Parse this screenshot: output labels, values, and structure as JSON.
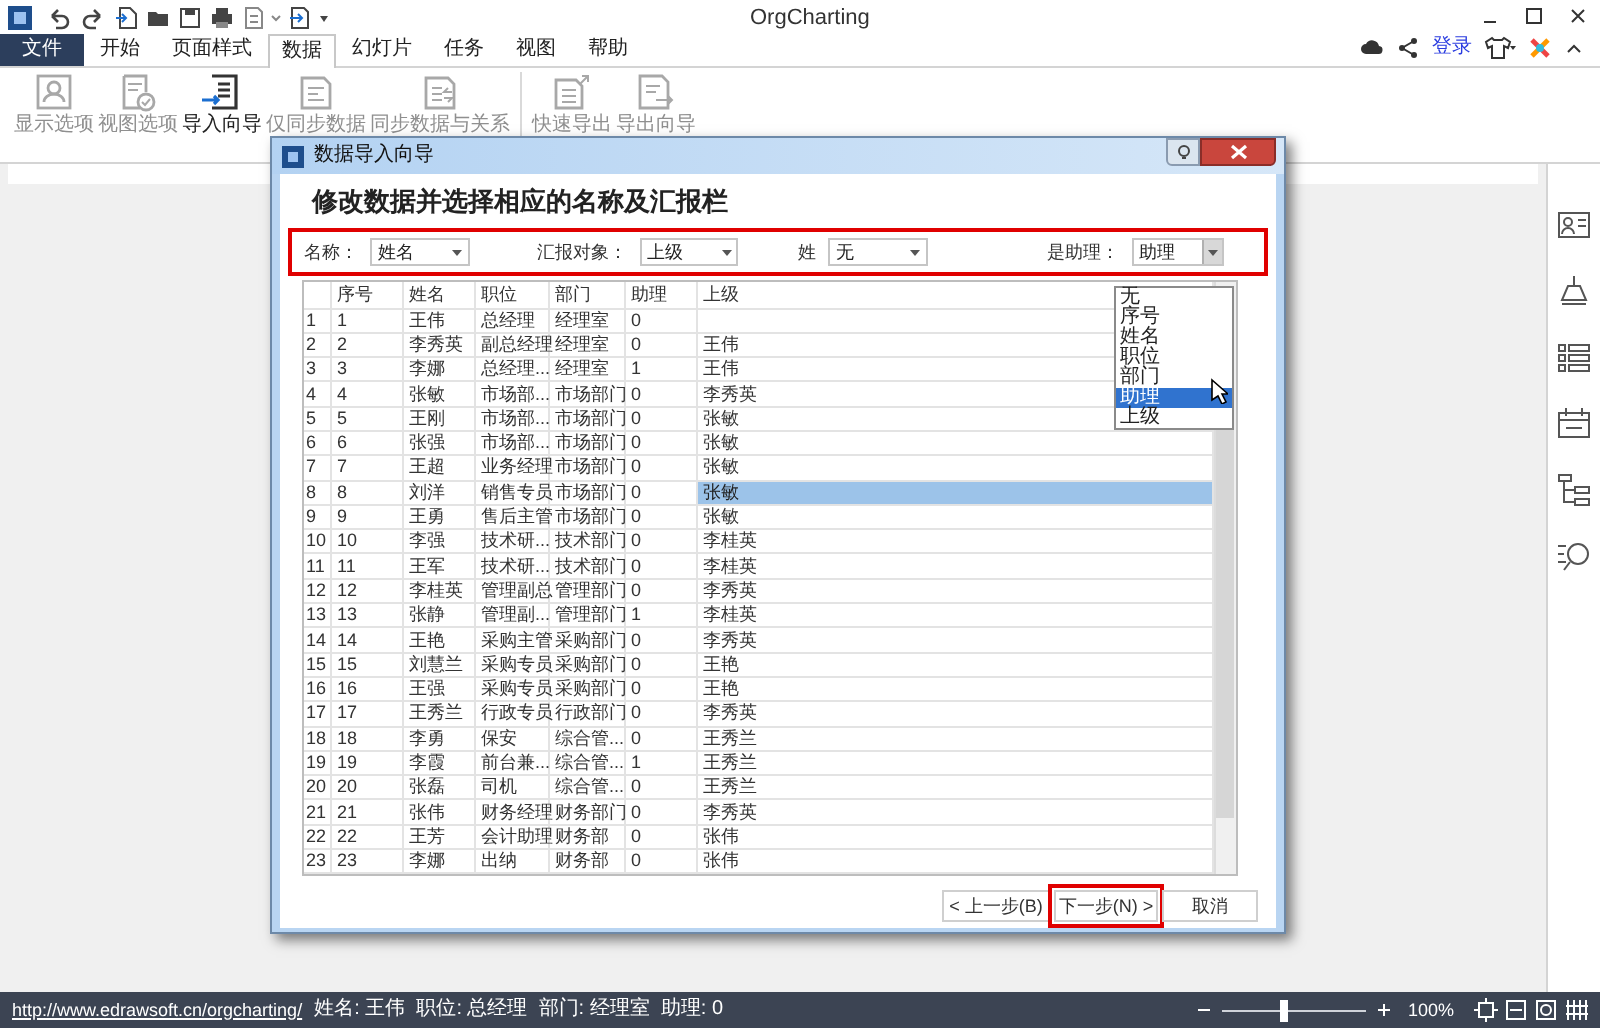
{
  "window": {
    "title": "OrgCharting",
    "login_link": "登录"
  },
  "menu_tabs": [
    {
      "label": "文件",
      "kind": "file",
      "selected": false
    },
    {
      "label": "开始",
      "kind": "tab",
      "selected": false
    },
    {
      "label": "页面样式",
      "kind": "tab",
      "selected": false
    },
    {
      "label": "数据",
      "kind": "tab",
      "selected": true
    },
    {
      "label": "幻灯片",
      "kind": "tab",
      "selected": false
    },
    {
      "label": "任务",
      "kind": "tab",
      "selected": false
    },
    {
      "label": "视图",
      "kind": "tab",
      "selected": false
    },
    {
      "label": "帮助",
      "kind": "tab",
      "selected": false
    }
  ],
  "ribbon_groups": [
    [
      {
        "label": "显示选项",
        "disabled": true
      },
      {
        "label": "视图选项",
        "disabled": true
      },
      {
        "label": "导入向导",
        "disabled": false
      },
      {
        "label": "仅同步数据",
        "disabled": true
      },
      {
        "label": "同步数据与关系",
        "disabled": true
      }
    ],
    [
      {
        "label": "快速导出",
        "disabled": true
      },
      {
        "label": "导出向导",
        "disabled": true
      }
    ]
  ],
  "dialog": {
    "title": "数据导入向导",
    "heading": "修改数据并选择相应的名称及汇报栏",
    "filter_bar": {
      "highlighted": true,
      "fields": [
        {
          "label": "名称：",
          "value": "姓名",
          "open": false
        },
        {
          "label": "汇报对象：",
          "value": "上级",
          "open": false
        },
        {
          "label": "姓",
          "value": "无",
          "open": false
        },
        {
          "label": "是助理：",
          "value": "助理",
          "open": true
        }
      ]
    },
    "dropdown_options": [
      {
        "label": "无",
        "selected": false
      },
      {
        "label": "序号",
        "selected": false
      },
      {
        "label": "姓名",
        "selected": false
      },
      {
        "label": "职位",
        "selected": false
      },
      {
        "label": "部门",
        "selected": false
      },
      {
        "label": "助理",
        "selected": true
      },
      {
        "label": "上级",
        "selected": false
      }
    ],
    "table": {
      "columns": [
        "序号",
        "姓名",
        "职位",
        "部门",
        "助理",
        "上级"
      ],
      "rows": [
        {
          "row_number": "1",
          "cells": [
            "1",
            "王伟",
            "总经理",
            "经理室",
            "0"
          ],
          "selected": false
        },
        {
          "row_number": "2",
          "cells": [
            "2",
            "李秀英",
            "副总经理",
            "经理室",
            "0",
            "王伟"
          ],
          "selected": false
        },
        {
          "row_number": "3",
          "cells": [
            "3",
            "李娜",
            "总经理...",
            "经理室",
            "1",
            "王伟"
          ],
          "selected": false
        },
        {
          "row_number": "4",
          "cells": [
            "4",
            "张敏",
            "市场部...",
            "市场部门",
            "0",
            "李秀英"
          ],
          "selected": false
        },
        {
          "row_number": "5",
          "cells": [
            "5",
            "王刚",
            "市场部...",
            "市场部门",
            "0",
            "张敏"
          ],
          "selected": false
        },
        {
          "row_number": "6",
          "cells": [
            "6",
            "张强",
            "市场部...",
            "市场部门",
            "0",
            "张敏"
          ],
          "selected": false
        },
        {
          "row_number": "7",
          "cells": [
            "7",
            "王超",
            "业务经理",
            "市场部门",
            "0",
            "张敏"
          ],
          "selected": false
        },
        {
          "row_number": "8",
          "cells": [
            "8",
            "刘洋",
            "销售专员",
            "市场部门",
            "0",
            "张敏"
          ],
          "selected": true
        },
        {
          "row_number": "9",
          "cells": [
            "9",
            "王勇",
            "售后主管",
            "市场部门",
            "0",
            "张敏"
          ],
          "selected": false
        },
        {
          "row_number": "10",
          "cells": [
            "10",
            "李强",
            "技术研...",
            "技术部门",
            "0",
            "李桂英"
          ],
          "selected": false
        },
        {
          "row_number": "11",
          "cells": [
            "11",
            "王军",
            "技术研...",
            "技术部门",
            "0",
            "李桂英"
          ],
          "selected": false
        },
        {
          "row_number": "12",
          "cells": [
            "12",
            "李桂英",
            "管理副总",
            "管理部门",
            "0",
            "李秀英"
          ],
          "selected": false
        },
        {
          "row_number": "13",
          "cells": [
            "13",
            "张静",
            "管理副...",
            "管理部门",
            "1",
            "李桂英"
          ],
          "selected": false
        },
        {
          "row_number": "14",
          "cells": [
            "14",
            "王艳",
            "采购主管",
            "采购部门",
            "0",
            "李秀英"
          ],
          "selected": false
        },
        {
          "row_number": "15",
          "cells": [
            "15",
            "刘慧兰",
            "采购专员",
            "采购部门",
            "0",
            "王艳"
          ],
          "selected": false
        },
        {
          "row_number": "16",
          "cells": [
            "16",
            "王强",
            "采购专员",
            "采购部门",
            "0",
            "王艳"
          ],
          "selected": false
        },
        {
          "row_number": "17",
          "cells": [
            "17",
            "王秀兰",
            "行政专员",
            "行政部门",
            "0",
            "李秀英"
          ],
          "selected": false
        },
        {
          "row_number": "18",
          "cells": [
            "18",
            "李勇",
            "保安",
            "综合管...",
            "0",
            "王秀兰"
          ],
          "selected": false
        },
        {
          "row_number": "19",
          "cells": [
            "19",
            "李霞",
            "前台兼...",
            "综合管...",
            "1",
            "王秀兰"
          ],
          "selected": false
        },
        {
          "row_number": "20",
          "cells": [
            "20",
            "张磊",
            "司机",
            "综合管...",
            "0",
            "王秀兰"
          ],
          "selected": false
        },
        {
          "row_number": "21",
          "cells": [
            "21",
            "张伟",
            "财务经理",
            "财务部门",
            "0",
            "李秀英"
          ],
          "selected": false
        },
        {
          "row_number": "22",
          "cells": [
            "22",
            "王芳",
            "会计助理",
            "财务部",
            "0",
            "张伟"
          ],
          "selected": false
        },
        {
          "row_number": "23",
          "cells": [
            "23",
            "李娜",
            "出纳",
            "财务部",
            "0",
            "张伟"
          ],
          "selected": false
        }
      ]
    },
    "buttons": [
      {
        "label": "< 上一步(B)",
        "highlighted": false
      },
      {
        "label": "下一步(N) >",
        "highlighted": true
      },
      {
        "label": "取消",
        "highlighted": false
      }
    ]
  },
  "status_bar": {
    "link": "http://www.edrawsoft.cn/orgcharting/",
    "info": "姓名: 王伟  职位: 总经理  部门: 经理室  助理: 0",
    "zoom": {
      "level": 0.45,
      "reading": "100%"
    }
  }
}
